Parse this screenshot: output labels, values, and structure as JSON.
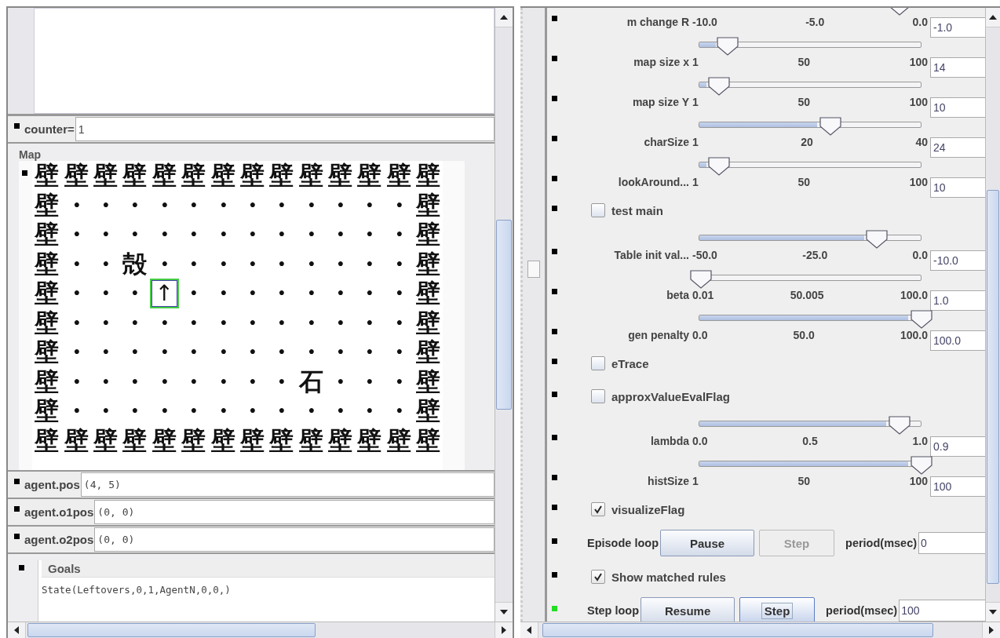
{
  "left_panel": {
    "counter": {
      "label": "counter=",
      "value": "1"
    },
    "map": {
      "title": "Map",
      "rows": [
        {
          "cells": "壁壁壁壁壁壁壁壁壁壁壁壁壁壁"
        },
        {
          "cells": "壁・・・・・・・・・・・・壁"
        },
        {
          "cells": "壁・・・・・・・・・・・・壁"
        },
        {
          "cells": "壁・・殻・・・・・・・・・壁"
        },
        {
          "before": "壁・・・",
          "agent": "↑",
          "after": "・・・・・・・・壁"
        },
        {
          "cells": "壁・・・・・・・・・・・・壁"
        },
        {
          "cells": "壁・・・・・・・・・・・・壁"
        },
        {
          "cells": "壁・・・・・・・・石・・・壁"
        },
        {
          "cells": "壁・・・・・・・・・・・・壁"
        },
        {
          "cells": "壁壁壁壁壁壁壁壁壁壁壁壁壁壁"
        }
      ]
    },
    "fields": [
      {
        "label": "agent.pos",
        "value": "(4, 5)"
      },
      {
        "label": "agent.o1pos",
        "value": "(0, 0)"
      },
      {
        "label": "agent.o2pos",
        "value": "(0, 0)"
      }
    ],
    "goals": {
      "title": "Goals",
      "text": "State(Leftovers,0,1,AgentN,0,0,)"
    }
  },
  "right_panel": {
    "rows": [
      {
        "kind": "slider",
        "label": "m change R",
        "ticks": [
          "-10.0",
          "-5.0",
          "0.0"
        ],
        "value": "-1.0",
        "level": 0.9,
        "color": "#000000"
      },
      {
        "kind": "slider",
        "label": "map size x",
        "ticks": [
          "1",
          "50",
          "100"
        ],
        "value": "14",
        "level": 0.13,
        "color": "#000000"
      },
      {
        "kind": "slider",
        "label": "map size Y",
        "ticks": [
          "1",
          "50",
          "100"
        ],
        "value": "10",
        "level": 0.09,
        "color": "#000000"
      },
      {
        "kind": "slider",
        "label": "charSize",
        "ticks": [
          "1",
          "20",
          "40"
        ],
        "value": "24",
        "level": 0.59,
        "color": "#000000"
      },
      {
        "kind": "slider",
        "label": "lookAround...",
        "ticks": [
          "1",
          "50",
          "100"
        ],
        "value": "10",
        "level": 0.09,
        "color": "#000000"
      },
      {
        "kind": "checkbox",
        "label": "test main",
        "checked": false,
        "color": "#000000"
      },
      {
        "kind": "slider",
        "label": "Table init val...",
        "ticks": [
          "-50.0",
          "-25.0",
          "0.0"
        ],
        "value": "-10.0",
        "level": 0.8,
        "color": "#000000"
      },
      {
        "kind": "slider",
        "label": "beta",
        "ticks": [
          "0.01",
          "50.005",
          "100.0"
        ],
        "value": "1.0",
        "level": 0.01,
        "color": "#000000"
      },
      {
        "kind": "slider",
        "label": "gen penalty",
        "ticks": [
          "0.0",
          "50.0",
          "100.0"
        ],
        "value": "100.0",
        "level": 1,
        "color": "#000000"
      },
      {
        "kind": "checkbox",
        "label": "eTrace",
        "checked": false,
        "color": "#000000"
      },
      {
        "kind": "checkbox",
        "label": "approxValueEvalFlag",
        "checked": false,
        "color": "#000000"
      },
      {
        "kind": "slider",
        "label": "lambda",
        "ticks": [
          "0.0",
          "0.5",
          "1.0"
        ],
        "value": "0.9",
        "level": 0.9,
        "color": "#000000"
      },
      {
        "kind": "slider",
        "label": "histSize",
        "ticks": [
          "1",
          "50",
          "100"
        ],
        "value": "100",
        "level": 1,
        "color": "#000000"
      },
      {
        "kind": "checkbox",
        "label": "visualizeFlag",
        "checked": true,
        "color": "#000000"
      },
      {
        "kind": "loop",
        "label": "Episode loop",
        "buttons": [
          {
            "label": "Pause",
            "disabled": false,
            "focused": false
          },
          {
            "label": "Step",
            "disabled": true,
            "focused": false
          }
        ],
        "period_label": "period(msec)",
        "period": "0",
        "color": "#000000"
      },
      {
        "kind": "checkbox",
        "label": "Show matched rules",
        "checked": true,
        "color": "#000000"
      },
      {
        "kind": "loop",
        "label": "Step loop",
        "buttons": [
          {
            "label": "Resume",
            "disabled": false,
            "focused": false
          },
          {
            "label": "Step",
            "disabled": false,
            "focused": true
          }
        ],
        "period_label": "period(msec)",
        "period": "100",
        "color": "#22dd22"
      }
    ]
  }
}
